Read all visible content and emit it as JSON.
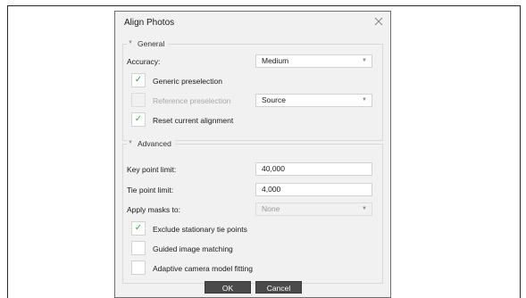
{
  "dialog": {
    "title": "Align Photos",
    "close_icon": "close-x-icon"
  },
  "general": {
    "legend": "General",
    "accuracy": {
      "label": "Accuracy:",
      "value": "Medium"
    },
    "generic_preselection": {
      "label": "Generic preselection",
      "checked": true
    },
    "reference_preselection": {
      "label": "Reference preselection",
      "checked": false,
      "enabled": false,
      "value": "Source"
    },
    "reset_alignment": {
      "label": "Reset current alignment",
      "checked": true
    }
  },
  "advanced": {
    "legend": "Advanced",
    "key_point_limit": {
      "label": "Key point limit:",
      "value": "40,000"
    },
    "tie_point_limit": {
      "label": "Tie point limit:",
      "value": "4,000"
    },
    "apply_masks": {
      "label": "Apply masks to:",
      "value": "None",
      "enabled": false
    },
    "exclude_stationary": {
      "label": "Exclude stationary tie points",
      "checked": true
    },
    "guided_matching": {
      "label": "Guided image matching",
      "checked": false
    },
    "adaptive_fitting": {
      "label": "Adaptive camera model fitting",
      "checked": false
    }
  },
  "buttons": {
    "ok": "OK",
    "cancel": "Cancel"
  },
  "colors": {
    "check": "#39a845",
    "button": "#4a4a4a",
    "dialog_bg": "#f1f1f1"
  }
}
